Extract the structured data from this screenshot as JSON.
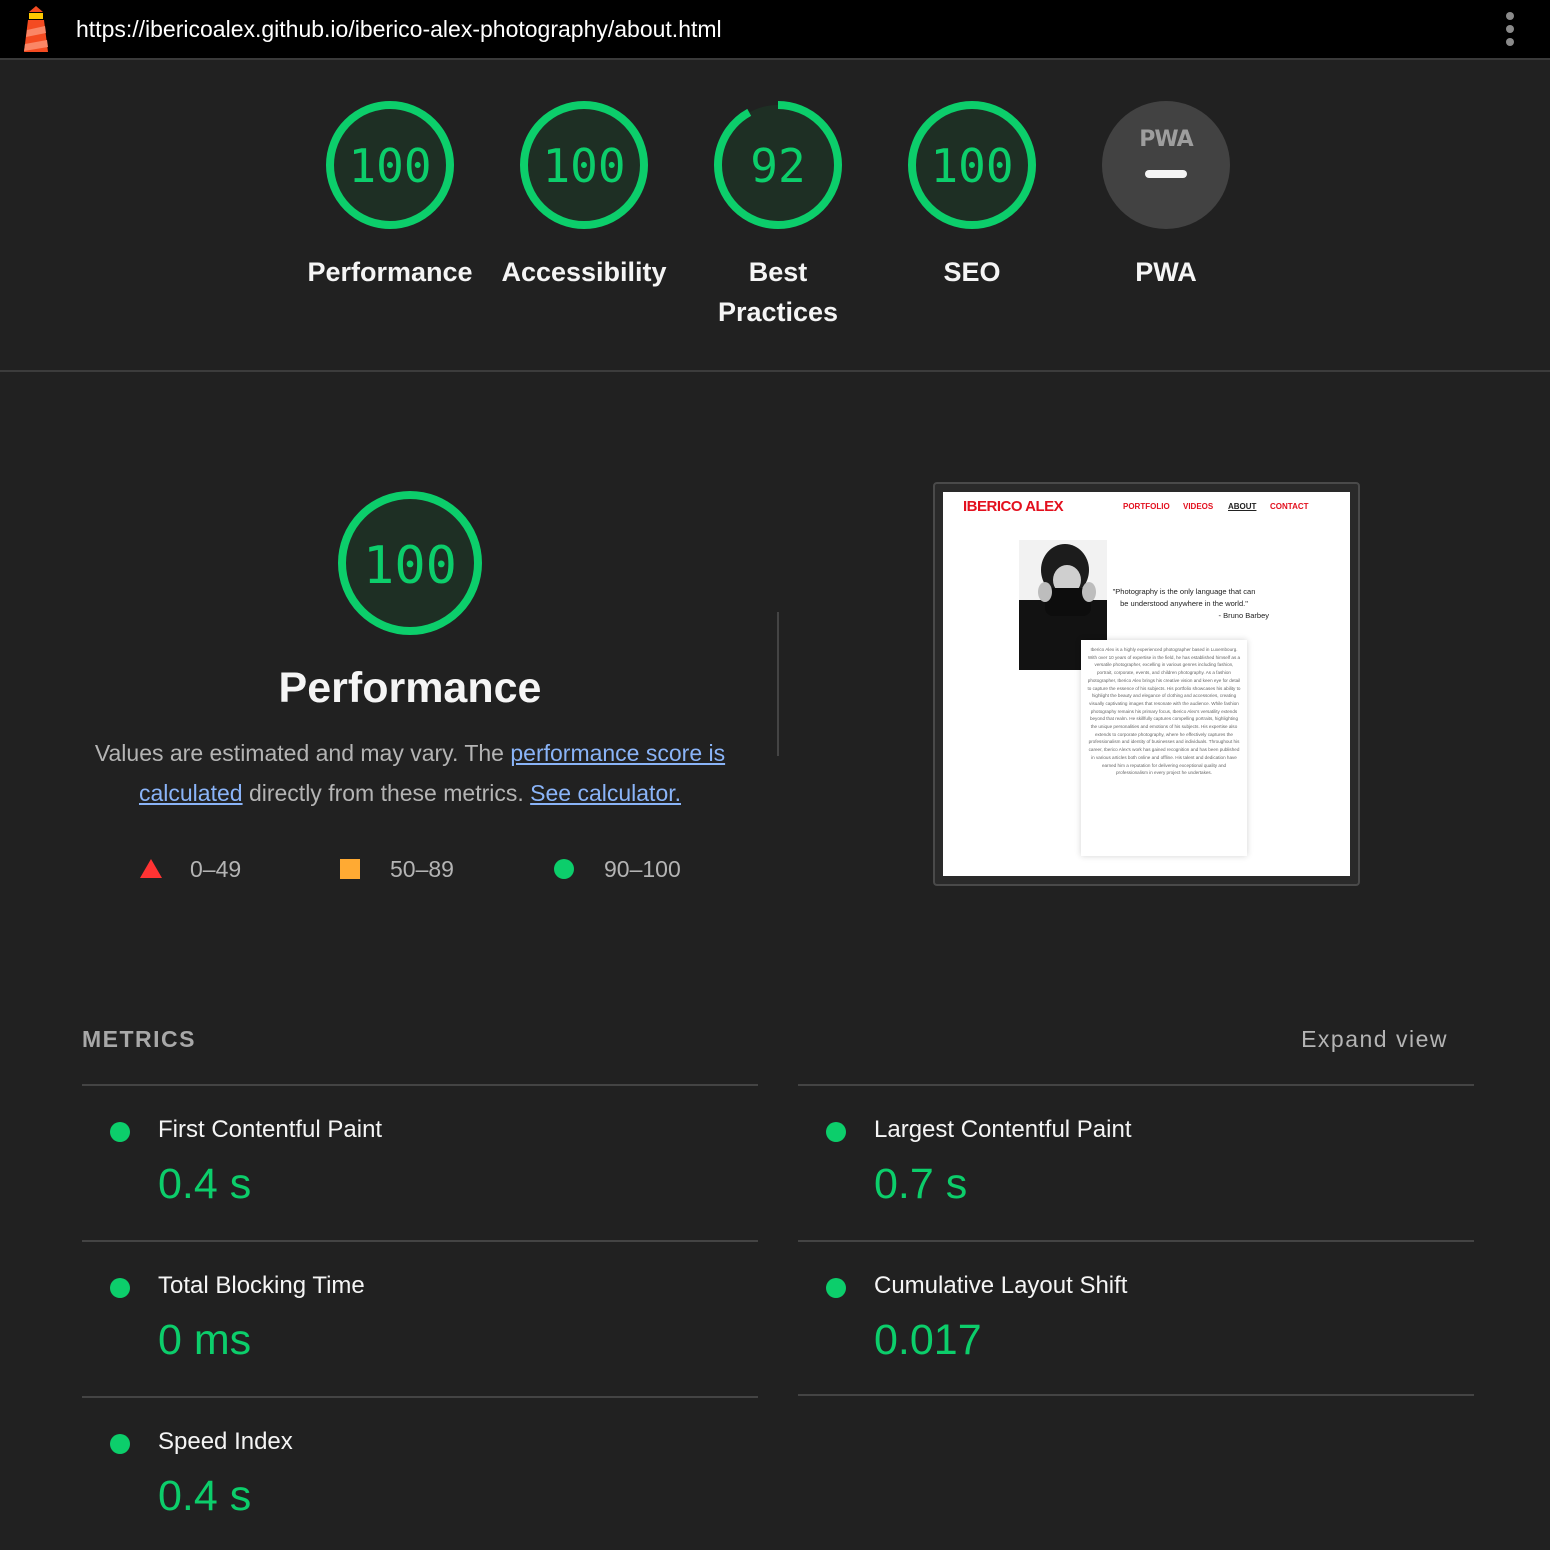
{
  "topbar": {
    "url": "https://ibericoalex.github.io/iberico-alex-photography/about.html",
    "logo_icon": "lighthouse-icon",
    "menu_icon": "kebab-menu-icon"
  },
  "gauges": [
    {
      "score": "100",
      "fraction": 1.0,
      "label_line1": "Performance",
      "label_line2": ""
    },
    {
      "score": "100",
      "fraction": 1.0,
      "label_line1": "Accessibility",
      "label_line2": ""
    },
    {
      "score": "92",
      "fraction": 0.92,
      "label_line1": "Best",
      "label_line2": "Practices"
    },
    {
      "score": "100",
      "fraction": 1.0,
      "label_line1": "SEO",
      "label_line2": ""
    },
    {
      "score_text": "PWA",
      "label_line1": "PWA",
      "label_line2": ""
    }
  ],
  "performance": {
    "score": "100",
    "title": "Performance",
    "desc_part1": "Values are estimated and may vary. The ",
    "desc_link1": "performance score is calculated",
    "desc_part2": " directly from these metrics. ",
    "desc_link2": "See calculator."
  },
  "legend": [
    {
      "shape": "triangle",
      "range": "0–49",
      "color": "#ff3333"
    },
    {
      "shape": "square",
      "range": "50–89",
      "color": "#ffaa33"
    },
    {
      "shape": "circle",
      "range": "90–100",
      "color": "#0cce6b"
    }
  ],
  "screenshot": {
    "brand": "IBERICO ALEX",
    "nav": [
      "PORTFOLIO",
      "VIDEOS",
      "ABOUT",
      "CONTACT"
    ],
    "quote_line1": "\"Photography is the only language that can",
    "quote_line2": "be understood anywhere in the world.\"",
    "quote_author": "- Bruno Barbey",
    "bio": "Iberico Alex is a highly experienced photographer based in Luxembourg. With over 10 years of expertise in the field, he has established himself as a versatile photographer, excelling in various genres including fashion, portrait, corporate, events, and children photography. As a fashion photographer, Iberico Alex brings his creative vision and keen eye for detail to capture the essence of his subjects. His portfolio showcases his ability to highlight the beauty and elegance of clothing and accessories, creating visually captivating images that resonate with the audience. While fashion photography remains his primary focus, Iberico Alex's versatility extends beyond that realm. He skillfully captures compelling portraits, highlighting the unique personalities and emotions of his subjects. His expertise also extends to corporate photography, where he effectively captures the professionalism and identity of businesses and individuals. Throughout his career, Iberico Alex's work has gained recognition and has been published in various articles both online and offline. His talent and dedication have earned him a reputation for delivering exceptional quality and professionalism in every project he undertakes."
  },
  "metrics": {
    "title": "METRICS",
    "expand_label": "Expand view",
    "items": [
      {
        "name": "First Contentful Paint",
        "value": "0.4 s"
      },
      {
        "name": "Largest Contentful Paint",
        "value": "0.7 s"
      },
      {
        "name": "Total Blocking Time",
        "value": "0 ms"
      },
      {
        "name": "Cumulative Layout Shift",
        "value": "0.017"
      },
      {
        "name": "Speed Index",
        "value": "0.4 s"
      }
    ]
  },
  "colors": {
    "pass": "#0cce6b",
    "pass_bg": "#1e2f24",
    "average": "#ffaa33",
    "fail": "#ff3333",
    "link": "#8ab4f8"
  }
}
